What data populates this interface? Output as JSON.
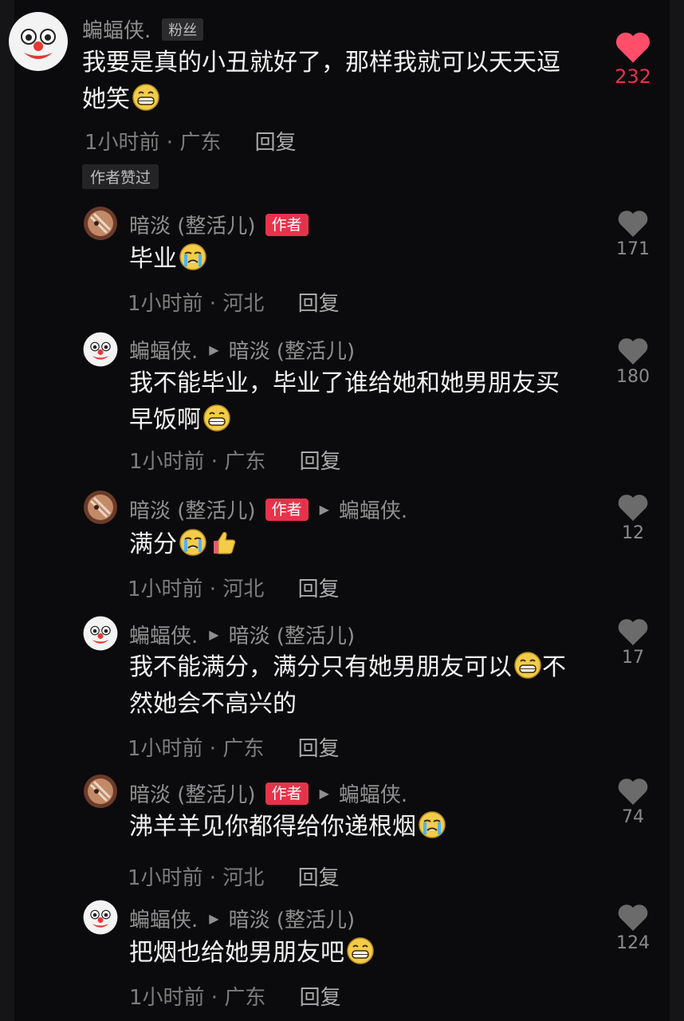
{
  "comments": [
    {
      "username": "蝙蝠侠.",
      "fan_badge": "粉丝",
      "line1": "我要是真的小丑就好了，那样我就可以天天逗",
      "line2": "她笑",
      "time_location": "1小时前 · 广东",
      "reply": "回复",
      "likes": "232",
      "liked_by_author": "作者赞过",
      "avatar": "clown-avatar",
      "emoji": "grin-emoji"
    },
    {
      "username": "暗淡 (整活儿)",
      "author_badge": "作者",
      "line1": "毕业",
      "time_location": "1小时前 · 河北",
      "reply": "回复",
      "likes": "171",
      "avatar": "author-avatar",
      "emoji": "crying-emoji"
    },
    {
      "username": "蝙蝠侠.",
      "reply_to": "暗淡 (整活儿)",
      "line1": "我不能毕业，毕业了谁给她和她男朋友买",
      "line2": "早饭啊",
      "time_location": "1小时前 · 广东",
      "reply": "回复",
      "likes": "180",
      "avatar": "clown-avatar",
      "emoji": "grin-emoji"
    },
    {
      "username": "暗淡 (整活儿)",
      "author_badge": "作者",
      "reply_to": "蝙蝠侠.",
      "line1": "满分",
      "time_location": "1小时前 · 河北",
      "reply": "回复",
      "likes": "12",
      "avatar": "author-avatar",
      "emoji": "crying-emoji thumbs-up-emoji"
    },
    {
      "username": "蝙蝠侠.",
      "reply_to": "暗淡 (整活儿)",
      "line1a": "我不能满分，满分只有她男朋友可以",
      "line1b": "不",
      "line2": "然她会不高兴的",
      "time_location": "1小时前 · 广东",
      "reply": "回复",
      "likes": "17",
      "avatar": "clown-avatar",
      "emoji": "grin-emoji"
    },
    {
      "username": "暗淡 (整活儿)",
      "author_badge": "作者",
      "reply_to": "蝙蝠侠.",
      "line1": "沸羊羊见你都得给你递根烟",
      "time_location": "1小时前 · 河北",
      "reply": "回复",
      "likes": "74",
      "avatar": "author-avatar",
      "emoji": "crying-emoji"
    },
    {
      "username": "蝙蝠侠.",
      "reply_to": "暗淡 (整活儿)",
      "line1": "把烟也给她男朋友吧",
      "time_location": "1小时前 · 广东",
      "reply": "回复",
      "likes": "124",
      "avatar": "clown-avatar",
      "emoji": "grin-emoji"
    }
  ],
  "colors": {
    "background": "#0b0b0d",
    "author_badge": "#e6334b",
    "liked_heart": "#ff4d6a",
    "inactive_heart": "#6b6b6b"
  }
}
